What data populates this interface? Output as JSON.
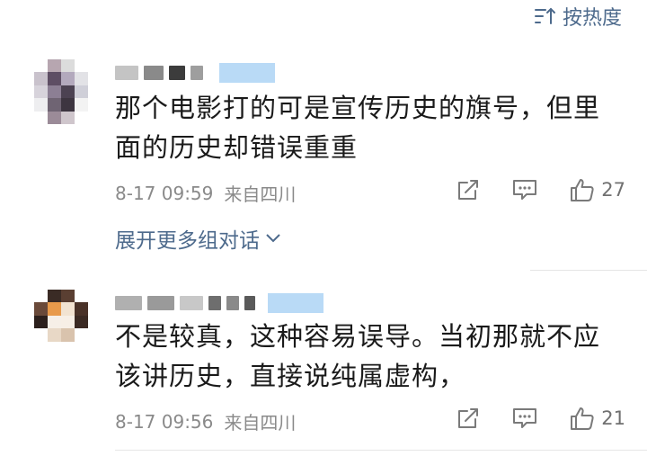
{
  "sort": {
    "label": "按热度"
  },
  "comments": [
    {
      "text_line1": "那个电影打的可是宣传历史的旗号，但里",
      "text_line2": "面的历史却错误重重",
      "date": "8-17 09:59",
      "source": "来自四川",
      "likes": "27"
    },
    {
      "text_line1": "不是较真，这种容易误导。当初那就不应",
      "text_line2": "该讲历史，直接说纯属虚构，",
      "date": "8-17 09:56",
      "source": "来自四川",
      "likes": "21"
    }
  ],
  "expand_replies": {
    "label": "展开更多组对话"
  },
  "colors": {
    "link": "#4d6a8c",
    "meta": "#8a8a8a",
    "vip": "#b9daf6"
  },
  "icons": [
    "sort-icon",
    "share-icon",
    "comment-icon",
    "like-icon",
    "chevron-down-icon"
  ]
}
